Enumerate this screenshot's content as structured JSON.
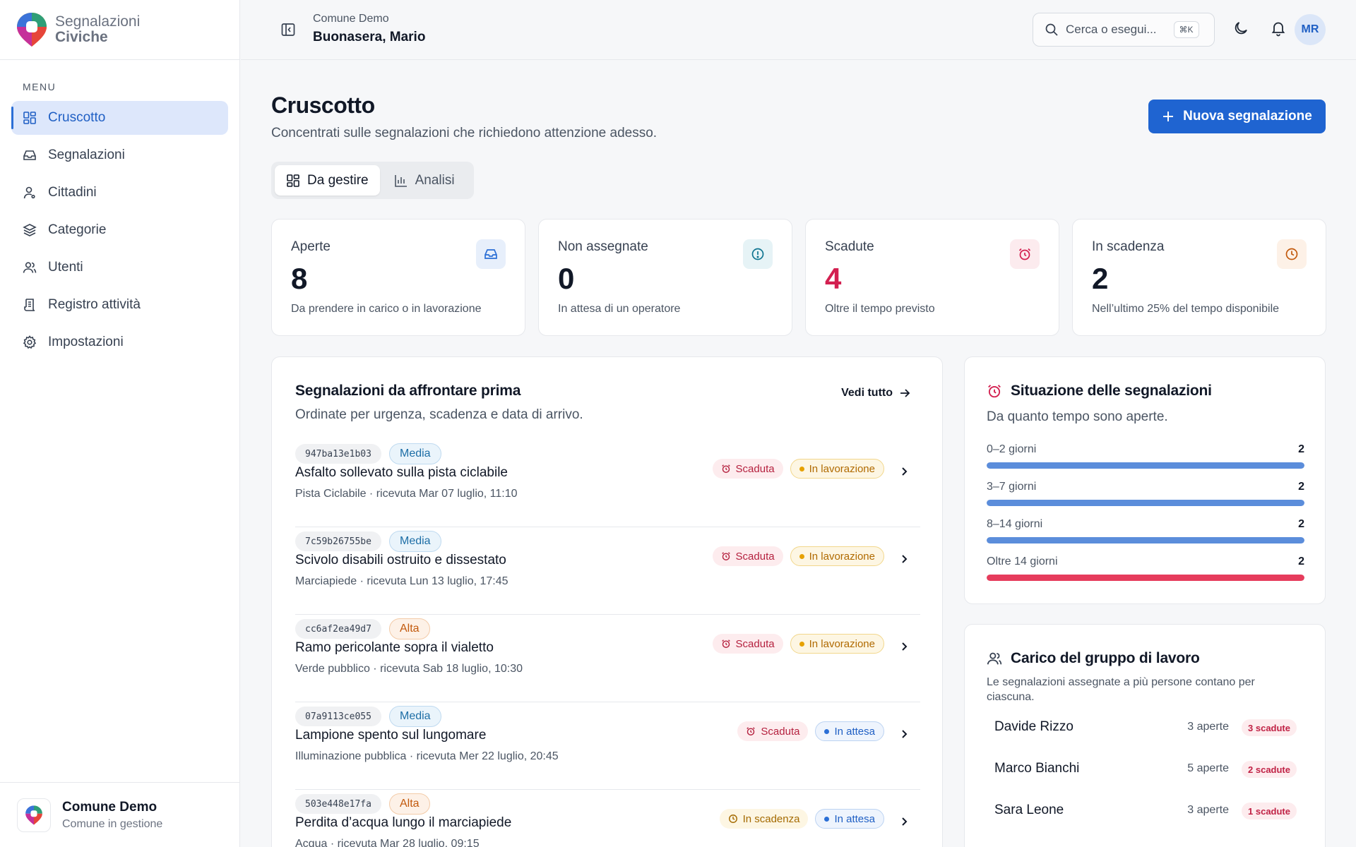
{
  "brand": {
    "line1": "Segnalazioni",
    "line2": "Civiche"
  },
  "sidebar": {
    "menu_title": "MENU",
    "items": [
      {
        "label": "Cruscotto",
        "icon": "dashboard-icon",
        "active": true
      },
      {
        "label": "Segnalazioni",
        "icon": "inbox-icon"
      },
      {
        "label": "Cittadini",
        "icon": "user-icon"
      },
      {
        "label": "Categorie",
        "icon": "layers-icon"
      },
      {
        "label": "Utenti",
        "icon": "users-icon"
      },
      {
        "label": "Registro attività",
        "icon": "log-icon"
      },
      {
        "label": "Impostazioni",
        "icon": "gear-icon"
      }
    ],
    "org": {
      "name": "Comune Demo",
      "sub": "Comune in gestione"
    }
  },
  "topbar": {
    "org": "Comune Demo",
    "user": "Buonasera, Mario",
    "search_placeholder": "Cerca o esegui...",
    "search_shortcut": "⌘K",
    "avatar": "MR"
  },
  "page": {
    "title": "Cruscotto",
    "subtitle": "Concentrati sulle segnalazioni che richiedono attenzione adesso.",
    "new_button": "Nuova segnalazione",
    "tabs": [
      {
        "label": "Da gestire",
        "active": true
      },
      {
        "label": "Analisi"
      }
    ]
  },
  "stats": [
    {
      "label": "Aperte",
      "value": "8",
      "desc": "Da prendere in carico o in lavorazione",
      "icon": "inbox-icon",
      "color": "#2b6fd6"
    },
    {
      "label": "Non assegnate",
      "value": "0",
      "desc": "In attesa di un operatore",
      "icon": "alert-circle-icon",
      "color": "#0e7490"
    },
    {
      "label": "Scadute",
      "value": "4",
      "desc": "Oltre il tempo previsto",
      "icon": "alarm-icon",
      "color": "#d32050"
    },
    {
      "label": "In scadenza",
      "value": "2",
      "desc": "Nell’ultimo 25% del tempo disponibile",
      "icon": "clock-icon",
      "color": "#c2590c"
    }
  ],
  "priority_list": {
    "title": "Segnalazioni da affrontare prima",
    "subtitle": "Ordinate per urgenza, scadenza e data di arrivo.",
    "see_all": "Vedi tutto",
    "rows": [
      {
        "code": "947ba13e1b03",
        "priority": "Media",
        "title": "Asfalto sollevato sulla pista ciclabile",
        "meta": "Pista Ciclabile · ricevuta Mar 07 luglio, 11:10",
        "badge1": "Scaduta",
        "badge2": "In lavorazione"
      },
      {
        "code": "7c59b26755be",
        "priority": "Media",
        "title": "Scivolo disabili ostruito e dissestato",
        "meta": "Marciapiede · ricevuta Lun 13 luglio, 17:45",
        "badge1": "Scaduta",
        "badge2": "In lavorazione"
      },
      {
        "code": "cc6af2ea49d7",
        "priority": "Alta",
        "title": "Ramo pericolante sopra il vialetto",
        "meta": "Verde pubblico · ricevuta Sab 18 luglio, 10:30",
        "badge1": "Scaduta",
        "badge2": "In lavorazione"
      },
      {
        "code": "07a9113ce055",
        "priority": "Media",
        "title": "Lampione spento sul lungomare",
        "meta": "Illuminazione pubblica · ricevuta Mer 22 luglio, 20:45",
        "badge1": "Scaduta",
        "badge2": "In attesa"
      },
      {
        "code": "503e448e17fa",
        "priority": "Alta",
        "title": "Perdita d’acqua lungo il marciapiede",
        "meta": "Acqua · ricevuta Mar 28 luglio, 09:15",
        "badge1": "In scadenza",
        "badge2": "In attesa"
      }
    ]
  },
  "situation": {
    "title": "Situazione delle segnalazioni",
    "subtitle": "Da quanto tempo sono aperte.",
    "bars": [
      {
        "label": "0–2 giorni",
        "value": "2",
        "fill": 1.0,
        "color": "#5b8ddb"
      },
      {
        "label": "3–7 giorni",
        "value": "2",
        "fill": 1.0,
        "color": "#5b8ddb"
      },
      {
        "label": "8–14 giorni",
        "value": "2",
        "fill": 1.0,
        "color": "#5b8ddb"
      },
      {
        "label": "Oltre 14 giorni",
        "value": "2",
        "fill": 1.0,
        "color": "#e63c5c"
      }
    ]
  },
  "workload": {
    "title": "Carico del gruppo di lavoro",
    "subtitle": "Le segnalazioni assegnate a più persone contano per ciascuna.",
    "people": [
      {
        "name": "Davide Rizzo",
        "open": "3 aperte",
        "overdue": "3 scadute"
      },
      {
        "name": "Marco Bianchi",
        "open": "5 aperte",
        "overdue": "2 scadute"
      },
      {
        "name": "Sara Leone",
        "open": "3 aperte",
        "overdue": "1 scadute"
      }
    ]
  }
}
